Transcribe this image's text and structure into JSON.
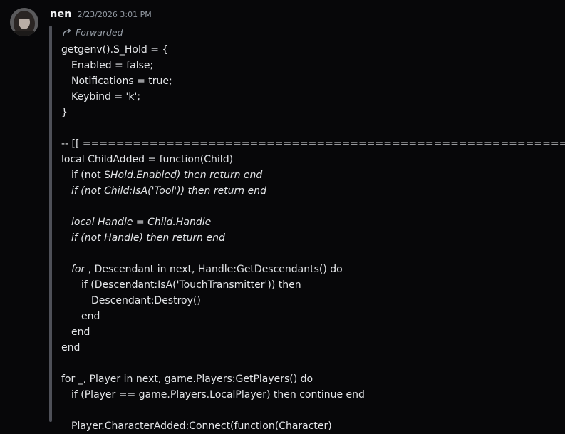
{
  "message": {
    "username": "nen",
    "timestamp": "2/23/2026 3:01 PM",
    "forwarded_label": "Forwarded"
  },
  "code": {
    "lines": [
      {
        "text": "getgenv().S_Hold = {",
        "indent": 0
      },
      {
        "text": "Enabled = false;",
        "indent": 1
      },
      {
        "text": "Notifications = true;",
        "indent": 1
      },
      {
        "text": "Keybind = 'k';",
        "indent": 1
      },
      {
        "text": "}",
        "indent": 0
      },
      {
        "text": "",
        "indent": 0
      },
      {
        "text": "-- [[ ===================================================================================================",
        "indent": 0
      },
      {
        "text": "local ChildAdded = function(Child)",
        "indent": 0
      },
      {
        "text": "if (not SHold.Enabled) then return end",
        "indent": 1,
        "italic_from": 9
      },
      {
        "text": "if (not Child:IsA('Tool')) then return end",
        "indent": 1,
        "italic": true
      },
      {
        "text": "",
        "indent": 0
      },
      {
        "text": "local Handle = Child.Handle",
        "indent": 1,
        "italic": true
      },
      {
        "text": "if (not Handle) then return end",
        "indent": 1,
        "italic": true
      },
      {
        "text": "",
        "indent": 0
      },
      {
        "text_italic": "for",
        "text": " , Descendant in next, Handle:GetDescendants() do",
        "indent": 1
      },
      {
        "text": "if (Descendant:IsA('TouchTransmitter')) then",
        "indent": 2
      },
      {
        "text": "Descendant:Destroy()",
        "indent": 3
      },
      {
        "text": "end",
        "indent": 2
      },
      {
        "text": "end",
        "indent": 1
      },
      {
        "text": "end",
        "indent": 0
      },
      {
        "text": "",
        "indent": 0
      },
      {
        "text": "for _, Player in next, game.Players:GetPlayers() do",
        "indent": 0
      },
      {
        "text": "if (Player == game.Players.LocalPlayer) then continue end",
        "indent": 1
      },
      {
        "text": "",
        "indent": 0
      },
      {
        "text": "Player.CharacterAdded:Connect(function(Character)",
        "indent": 1
      }
    ]
  }
}
